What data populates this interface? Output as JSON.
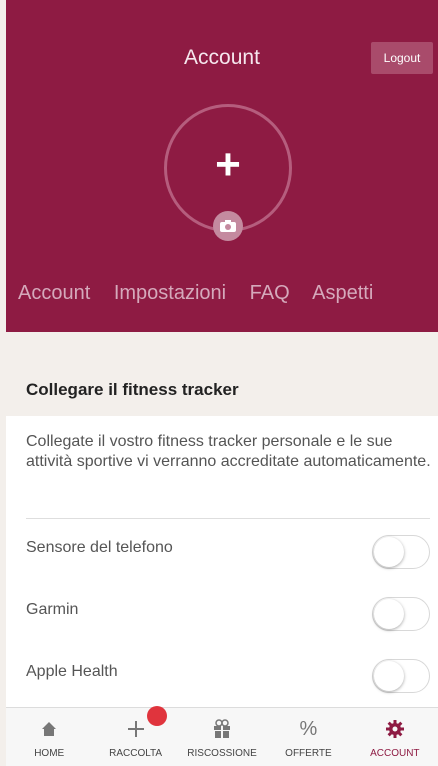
{
  "header": {
    "title": "Account",
    "logout_label": "Logout",
    "tabs": [
      "Account",
      "Impostazioni",
      "FAQ",
      "Aspetti"
    ]
  },
  "section": {
    "title": "Collegare il fitness tracker"
  },
  "content": {
    "description": "Collegate il vostro fitness tracker personale e le sue attività sportive vi verranno accreditate automaticamente.",
    "trackers": [
      {
        "label": "Sensore del telefono",
        "enabled": false
      },
      {
        "label": "Garmin",
        "enabled": false
      },
      {
        "label": "Apple Health",
        "enabled": false
      }
    ]
  },
  "tabbar": {
    "items": [
      {
        "label": "HOME",
        "icon": "home-icon"
      },
      {
        "label": "RACCOLTA",
        "icon": "plus-icon"
      },
      {
        "label": "RISCOSSIONE",
        "icon": "gift-icon"
      },
      {
        "label": "OFFERTE",
        "icon": "percent-icon"
      },
      {
        "label": "ACCOUNT",
        "icon": "gear-icon"
      }
    ],
    "active": "ACCOUNT"
  },
  "colors": {
    "brand": "#8e1b43",
    "notification": "#e0343d"
  }
}
